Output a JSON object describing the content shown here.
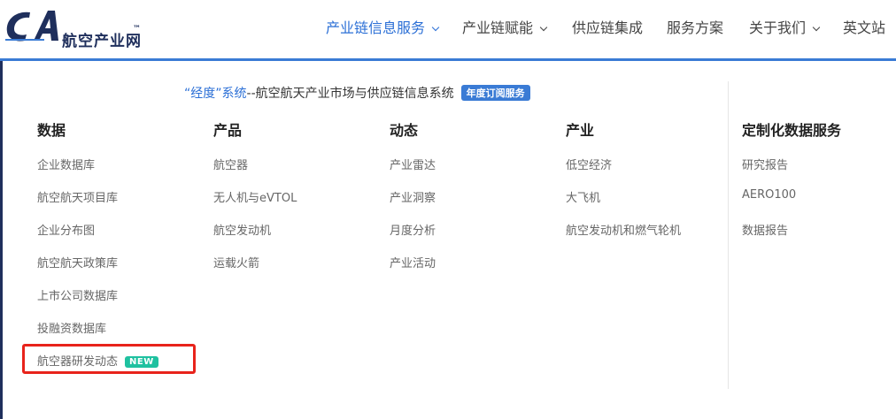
{
  "logo": {
    "mark": "CA",
    "name": "航空产业网",
    "tm": "™"
  },
  "nav": [
    {
      "label": "产业链信息服务",
      "active": true,
      "dropdown": true
    },
    {
      "label": "产业链赋能",
      "active": false,
      "dropdown": true
    },
    {
      "label": "供应链集成",
      "active": false,
      "dropdown": false
    },
    {
      "label": "服务方案",
      "active": false,
      "dropdown": false
    },
    {
      "label": "关于我们",
      "active": false,
      "dropdown": true
    },
    {
      "label": "英文站",
      "active": false,
      "dropdown": false
    }
  ],
  "system": {
    "highlight": "“经度”系统",
    "rest": "--航空航天产业市场与供应链信息系统",
    "badge": "年度订阅服务"
  },
  "columns": [
    {
      "title": "数据",
      "items": [
        "企业数据库",
        "航空航天项目库",
        "企业分布图",
        "航空航天政策库",
        "上市公司数据库",
        "投融资数据库",
        "航空器研发动态"
      ]
    },
    {
      "title": "产品",
      "items": [
        "航空器",
        "无人机与eVTOL",
        "航空发动机",
        "运载火箭"
      ]
    },
    {
      "title": "动态",
      "items": [
        "产业雷达",
        "产业洞察",
        "月度分析",
        "产业活动"
      ]
    },
    {
      "title": "产业",
      "items": [
        "低空经济",
        "大飞机",
        "航空发动机和燃气轮机"
      ]
    },
    {
      "title": "定制化数据服务",
      "items": [
        "研究报告",
        "AERO100",
        "数据报告"
      ]
    }
  ],
  "new_badge": "NEW",
  "colors": {
    "accent": "#2b6fd6",
    "brand_dark": "#1f2f5c",
    "new_badge": "#1fc1a0",
    "highlight_box": "#e8231b"
  }
}
